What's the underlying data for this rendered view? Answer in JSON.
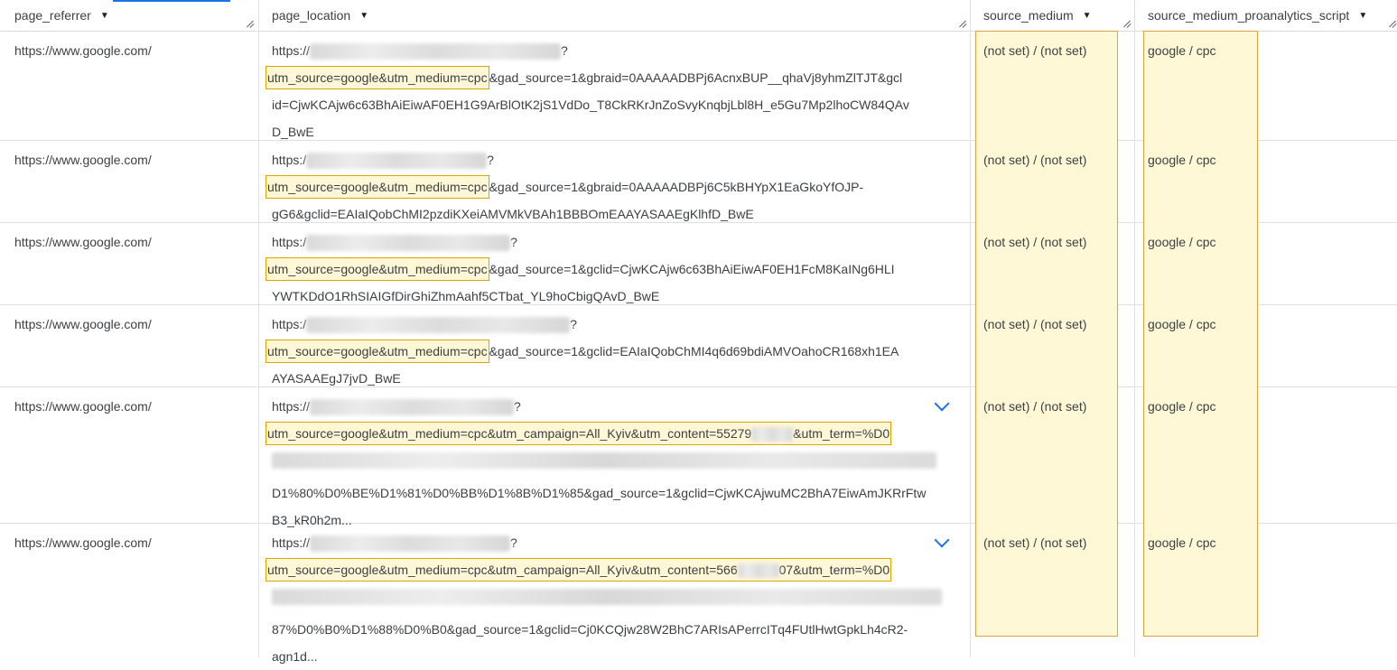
{
  "columns": [
    {
      "label": "page_referrer"
    },
    {
      "label": "page_location"
    },
    {
      "label": "source_medium"
    },
    {
      "label": "source_medium_proanalytics_script"
    }
  ],
  "rows": [
    {
      "referrer": "https://www.google.com/",
      "loc_prefix": "https://",
      "loc_suffix": "?",
      "utm": "utm_source=google&utm_medium=cpc",
      "line2_rest": "&gad_source=1&gbraid=0AAAAADBPj6AcnxBUP__qhaVj8yhmZlTJT&gcl",
      "line3": "id=CjwKCAjw6c63BhAiEiwAF0EH1G9ArBlOtK2jS1VdDo_T8CkRKrJnZoSvyKnqbjLbl8H_e5Gu7Mp2lhoCW84QAv",
      "line4": "D_BwE",
      "source_medium": "(not set) / (not set)",
      "proanalytics": "google / cpc"
    },
    {
      "referrer": "https://www.google.com/",
      "loc_prefix": "https:/",
      "loc_suffix": "?",
      "utm": "utm_source=google&utm_medium=cpc",
      "line2_rest": "&gad_source=1&gbraid=0AAAAADBPj6C5kBHYpX1EaGkoYfOJP-",
      "line3": "gG6&gclid=EAIaIQobChMI2pzdiKXeiAMVMkVBAh1BBBOmEAAYASAAEgKlhfD_BwE",
      "source_medium": "(not set) / (not set)",
      "proanalytics": "google / cpc"
    },
    {
      "referrer": "https://www.google.com/",
      "loc_prefix": "https:/",
      "loc_suffix": "?",
      "utm": "utm_source=google&utm_medium=cpc",
      "line2_rest": "&gad_source=1&gclid=CjwKCAjw6c63BhAiEiwAF0EH1FcM8KaINg6HLI",
      "line3": "YWTKDdO1RhSIAIGfDirGhiZhmAahf5CTbat_YL9hoCbigQAvD_BwE",
      "source_medium": "(not set) / (not set)",
      "proanalytics": "google / cpc"
    },
    {
      "referrer": "https://www.google.com/",
      "loc_prefix": "https:/",
      "loc_suffix": "?",
      "utm": "utm_source=google&utm_medium=cpc",
      "line2_rest": "&gad_source=1&gclid=EAIaIQobChMI4q6d69bdiAMVOahoCR168xh1EA",
      "line3": "AYASAAEgJ7jvD_BwE",
      "source_medium": "(not set) / (not set)",
      "proanalytics": "google / cpc"
    },
    {
      "referrer": "https://www.google.com/",
      "loc_prefix": "https://",
      "loc_suffix": "?",
      "utm_a": "utm_source=google&utm_medium=cpc&utm_campaign=All_Kyiv&utm_content=55279",
      "utm_b": "&utm_term=%D0",
      "line4": "D1%80%D0%BE%D1%81%D0%BB%D1%8B%D1%85&gad_source=1&gclid=CjwKCAjwuMC2BhA7EiwAmJKRrFtw",
      "line5": "B3_kR0h2m...",
      "source_medium": "(not set) / (not set)",
      "proanalytics": "google / cpc"
    },
    {
      "referrer": "https://www.google.com/",
      "loc_prefix": "https://",
      "loc_suffix": "?",
      "utm_a": "utm_source=google&utm_medium=cpc&utm_campaign=All_Kyiv&utm_content=566",
      "utm_b": "07&utm_term=%D0",
      "line4": "87%D0%B0%D1%88%D0%B0&gad_source=1&gclid=Cj0KCQjw28W2BhC7ARIsAPerrcITq4FUtlHwtGpkLh4cR2-",
      "line5": "agn1d...",
      "source_medium": "(not set) / (not set)",
      "proanalytics": "google / cpc"
    }
  ]
}
